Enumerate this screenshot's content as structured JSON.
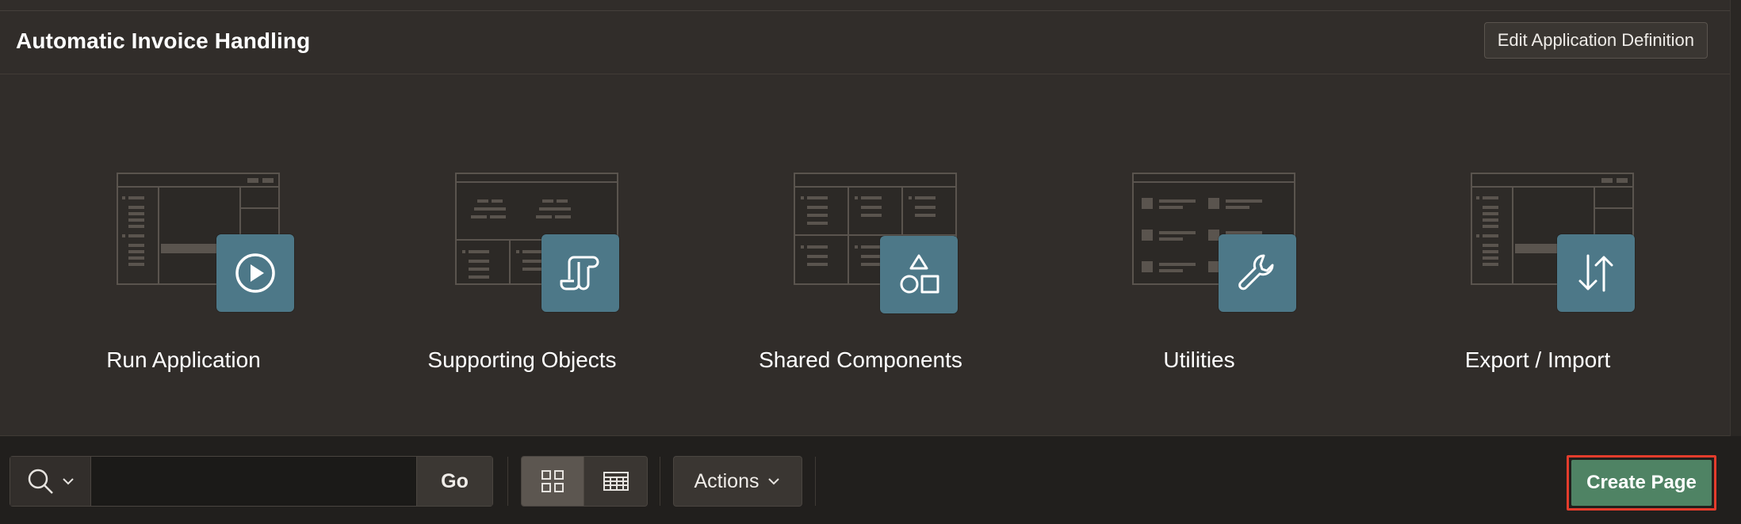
{
  "header": {
    "title": "Automatic Invoice Handling",
    "edit_label": "Edit Application Definition"
  },
  "tiles": [
    {
      "label": "Run Application",
      "icon": "play-icon"
    },
    {
      "label": "Supporting Objects",
      "icon": "scroll-icon"
    },
    {
      "label": "Shared Components",
      "icon": "shapes-icon"
    },
    {
      "label": "Utilities",
      "icon": "wrench-icon"
    },
    {
      "label": "Export / Import",
      "icon": "arrows-up-down-icon"
    }
  ],
  "toolbar": {
    "search_value": "",
    "search_icon": "search-icon",
    "go_label": "Go",
    "view_grid_icon": "grid-view-icon",
    "view_report_icon": "report-view-icon",
    "actions_label": "Actions",
    "create_label": "Create Page"
  },
  "colors": {
    "background": "#312d2a",
    "toolbar_background": "#211f1d",
    "badge": "#4d7888",
    "create_button": "#4f8364",
    "highlight_border": "#e43c2c"
  }
}
